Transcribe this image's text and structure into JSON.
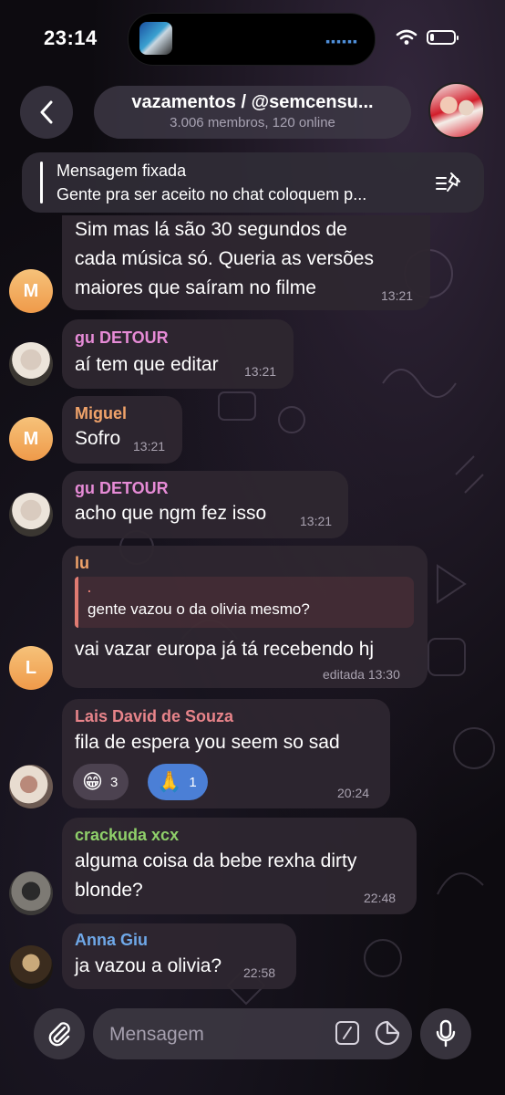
{
  "status_bar": {
    "time": "23:14"
  },
  "header": {
    "title": "vazamentos / @semcensu...",
    "subtitle": "3.006 membros, 120 online"
  },
  "pinned": {
    "title": "Mensagem fixada",
    "text": "Gente pra ser aceito no chat coloquem p..."
  },
  "messages": [
    {
      "avatar": "M",
      "lines": [
        "Sim mas lá são 30 segundos de",
        "cada música só. Queria as versões",
        "maiores que saíram no filme"
      ],
      "time": "13:21"
    },
    {
      "sender": "gu DETOUR",
      "sender_color": "#e68bd6",
      "text": "aí tem que editar",
      "time": "13:21"
    },
    {
      "sender": "Miguel",
      "sender_color": "#f0a36a",
      "avatar": "M",
      "text": "Sofro",
      "time": "13:21"
    },
    {
      "sender": "gu DETOUR",
      "sender_color": "#e68bd6",
      "text": "acho que ngm fez isso",
      "time": "13:21"
    },
    {
      "sender": "lu",
      "sender_color": "#f0a36a",
      "avatar": "L",
      "reply": {
        "name": ".",
        "text": "gente vazou o da olivia mesmo?"
      },
      "text": "vai vazar europa já tá recebendo hj",
      "time": "editada 13:30"
    },
    {
      "sender": "Lais David de Souza",
      "sender_color": "#e8848a",
      "text": "fila de espera you seem so sad",
      "reactions": [
        {
          "emoji": "😁",
          "count": "3"
        },
        {
          "emoji": "🙏",
          "count": "1"
        }
      ],
      "time": "20:24"
    },
    {
      "sender": "crackuda xcx",
      "sender_color": "#8fcf6a",
      "lines": [
        "alguma coisa da bebe rexha dirty",
        "blonde?"
      ],
      "time": "22:48"
    },
    {
      "sender": "Anna Giu",
      "sender_color": "#6fa8e8",
      "text": "ja vazou a olivia?",
      "time": "22:58"
    }
  ],
  "composer": {
    "placeholder": "Mensagem"
  },
  "icons": [
    "back-chevron-icon",
    "wifi-icon",
    "battery-icon",
    "pin-list-icon",
    "paperclip-icon",
    "command-icon",
    "sticker-icon",
    "microphone-icon"
  ],
  "colors": {
    "accent": "#4b7fd6",
    "bubble": "#2e2630",
    "background": "#0d0b10"
  }
}
